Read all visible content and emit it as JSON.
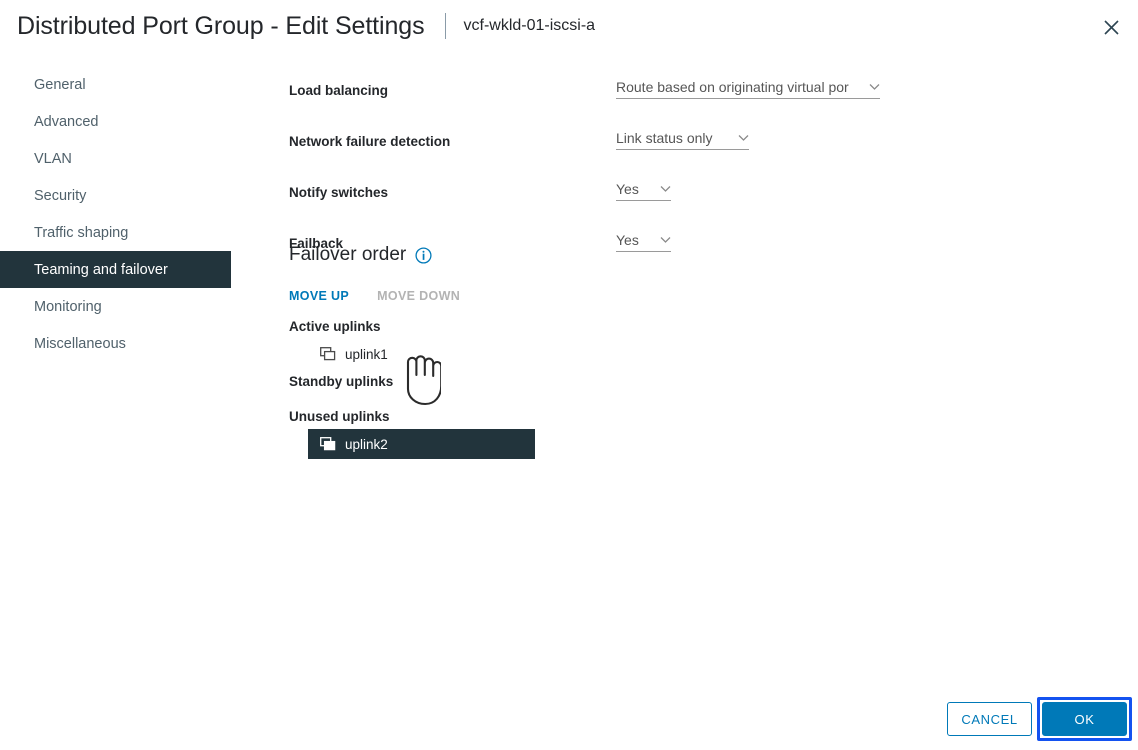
{
  "header": {
    "title": "Distributed Port Group - Edit Settings",
    "subtitle": "vcf-wkld-01-iscsi-a",
    "close_icon": "close-icon"
  },
  "sidebar": {
    "items": [
      {
        "label": "General",
        "selected": false
      },
      {
        "label": "Advanced",
        "selected": false
      },
      {
        "label": "VLAN",
        "selected": false
      },
      {
        "label": "Security",
        "selected": false
      },
      {
        "label": "Traffic shaping",
        "selected": false
      },
      {
        "label": "Teaming and failover",
        "selected": true
      },
      {
        "label": "Monitoring",
        "selected": false
      },
      {
        "label": "Miscellaneous",
        "selected": false
      }
    ]
  },
  "form": {
    "fields": [
      {
        "label": "Load balancing",
        "value": "Route based on originating virtual por",
        "width": "w-wide",
        "caret_icon": "chevron-down-icon"
      },
      {
        "label": "Network failure detection",
        "value": "Link status only",
        "width": "w-mid",
        "caret_icon": "chevron-down-icon"
      },
      {
        "label": "Notify switches",
        "value": "Yes",
        "width": "w-small",
        "caret_icon": "chevron-down-icon"
      },
      {
        "label": "Failback",
        "value": "Yes",
        "width": "w-small",
        "caret_icon": "chevron-down-icon"
      }
    ]
  },
  "failover": {
    "title": "Failover order",
    "info_icon": "info-icon",
    "move_up_label": "MOVE UP",
    "move_down_label": "MOVE DOWN",
    "move_down_disabled": true,
    "groups": [
      {
        "label": "Active uplinks",
        "uplinks": [
          {
            "name": "uplink1",
            "icon": "network-adapter-icon",
            "selected": false
          }
        ]
      },
      {
        "label": "Standby uplinks",
        "uplinks": []
      },
      {
        "label": "Unused uplinks",
        "uplinks": [
          {
            "name": "uplink2",
            "icon": "network-adapter-icon",
            "selected": true
          }
        ]
      }
    ]
  },
  "footer": {
    "cancel_label": "CANCEL",
    "ok_label": "OK"
  },
  "colors": {
    "accent": "#0079b8",
    "selected_bg": "#22343c",
    "focus_ring": "#1452f0",
    "label_text": "#24272b",
    "muted_text": "#50616b",
    "disabled_text": "#b3b3b3"
  },
  "cursor": {
    "type": "pointing-hand-cursor"
  }
}
